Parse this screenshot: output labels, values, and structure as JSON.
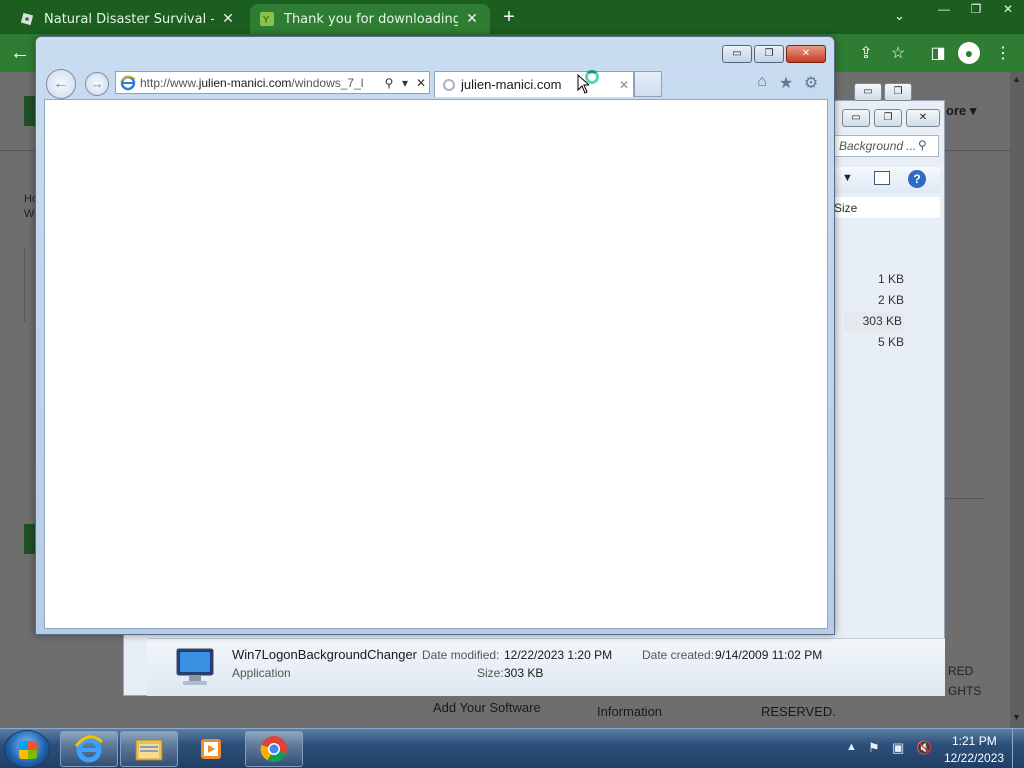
{
  "chrome": {
    "tabs": [
      {
        "title": "Natural Disaster Survival - Roblo",
        "active": false
      },
      {
        "title": "Thank you for downloading Wind",
        "active": true
      }
    ],
    "new_tab": "+",
    "dropdown": "⌄",
    "controls": [
      "—",
      "❐",
      "✕"
    ],
    "accent": "#1b5e20",
    "toolbar_accent": "#2e7d32"
  },
  "webpage": {
    "more_label": "ore ▾",
    "left_text_1": "Ho",
    "left_text_2": "W",
    "footer": {
      "add_software": "Add Your Software",
      "information": "Information",
      "reserved": "RESERVED.",
      "rights_1": "RED",
      "rights_2": "GHTS"
    }
  },
  "explorer": {
    "search_placeholder": "Background ...",
    "size_header": "Size",
    "sizes": [
      "1 KB",
      "2 KB",
      "303 KB",
      "5 KB"
    ],
    "details": {
      "name": "Win7LogonBackgroundChanger",
      "type": "Application",
      "date_modified_label": "Date modified:",
      "date_modified": "12/22/2023 1:20 PM",
      "size_label": "Size:",
      "size": "303 KB",
      "date_created_label": "Date created:",
      "date_created": "9/14/2009 11:02 PM"
    }
  },
  "ie": {
    "url_prefix": "http://www.",
    "url_domain": "julien-manici.com",
    "url_suffix": "/windows_7_l",
    "tab_title": "julien-manici.com",
    "controls": {
      "minimize": "▭",
      "maximize": "❐",
      "close": "✕"
    }
  },
  "taskbar": {
    "time": "1:21 PM",
    "date": "12/22/2023"
  }
}
